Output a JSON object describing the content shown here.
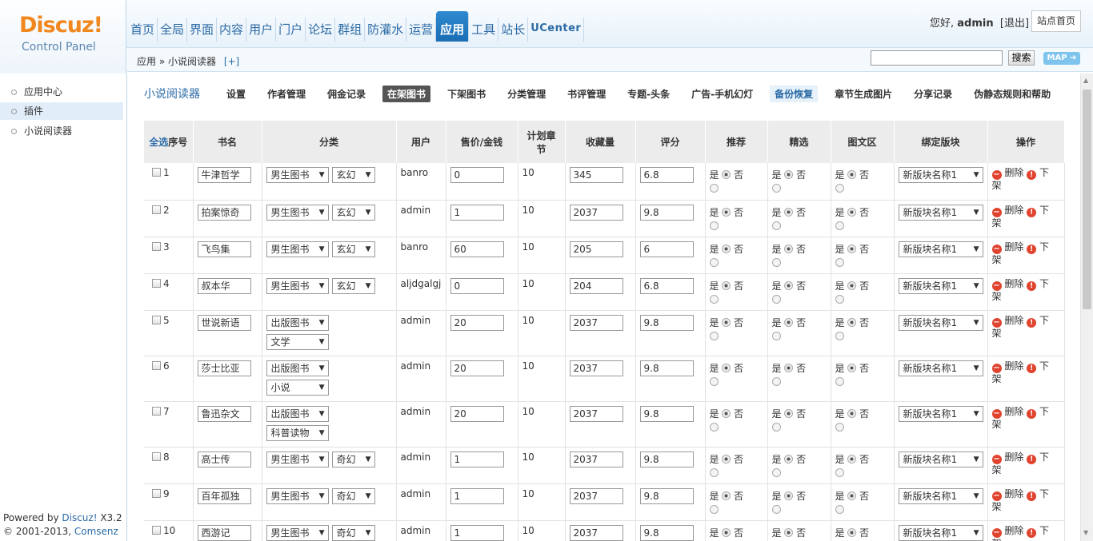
{
  "header": {
    "logo_brand": "Discuz!",
    "logo_sub": "Control Panel",
    "nav": [
      "首页",
      "全局",
      "界面",
      "内容",
      "用户",
      "门户",
      "论坛",
      "群组",
      "防灌水",
      "运营",
      "应用",
      "工具",
      "站长",
      "UCenter"
    ],
    "active_nav": "应用",
    "greeting": "您好,",
    "username": "admin",
    "logout": "[退出]",
    "site_home": "站点首页"
  },
  "subbar": {
    "breadcrumb": "应用 » 小说阅读器",
    "add_label": "[+]",
    "search_button": "搜索",
    "map_button": "MAP ➜"
  },
  "sidebar": {
    "items": [
      "应用中心",
      "插件",
      "小说阅读器"
    ],
    "active_item": "插件",
    "footer_powered": "Powered by ",
    "footer_brand": "Discuz!",
    "footer_version": " X3.2",
    "footer_copyright": "© 2001-2013, ",
    "footer_company": "Comsenz Inc."
  },
  "tabs": {
    "app_title": "小说阅读器",
    "items": [
      "设置",
      "作者管理",
      "佣金记录",
      "在架图书",
      "下架图书",
      "分类管理",
      "书评管理",
      "专题-头条",
      "广告-手机幻灯",
      "备份恢复",
      "章节生成图片",
      "分享记录",
      "伪静态规则和帮助"
    ],
    "active_tab": "在架图书",
    "highlighted_tab": "备份恢复"
  },
  "table": {
    "headers": {
      "select_all": "全选",
      "index": "序号",
      "book": "书名",
      "category": "分类",
      "user": "用户",
      "price": "售价/金钱",
      "chapters": "计划章节",
      "favorites": "收藏量",
      "score": "评分",
      "recommend": "推荐",
      "featured": "精选",
      "picture": "图文区",
      "block": "绑定版块",
      "actions": "操作"
    },
    "yes": "是",
    "no": "否",
    "delete": "删除",
    "offshelf_1": "下",
    "offshelf_2": "架",
    "rows": [
      {
        "idx": "1",
        "title": "牛津哲学",
        "cat1": "男生图书",
        "cat2": "玄幻",
        "user": "banro",
        "price": "0",
        "chapters": "10",
        "fav": "345",
        "score": "6.8",
        "block": "新版块名称1"
      },
      {
        "idx": "2",
        "title": "拍案惊奇",
        "cat1": "男生图书",
        "cat2": "玄幻",
        "user": "admin",
        "price": "1",
        "chapters": "10",
        "fav": "2037",
        "score": "9.8",
        "block": "新版块名称1"
      },
      {
        "idx": "3",
        "title": "飞鸟集",
        "cat1": "男生图书",
        "cat2": "玄幻",
        "user": "banro",
        "price": "60",
        "chapters": "10",
        "fav": "205",
        "score": "6",
        "block": "新版块名称1"
      },
      {
        "idx": "4",
        "title": "叔本华",
        "cat1": "男生图书",
        "cat2": "玄幻",
        "user": "aljdgalgj",
        "price": "0",
        "chapters": "10",
        "fav": "204",
        "score": "6.8",
        "block": "新版块名称1"
      },
      {
        "idx": "5",
        "title": "世说新语",
        "cat1": "出版图书",
        "cat2": "文学",
        "user": "admin",
        "price": "20",
        "chapters": "10",
        "fav": "2037",
        "score": "9.8",
        "block": "新版块名称1",
        "stacked": true
      },
      {
        "idx": "6",
        "title": "莎士比亚",
        "cat1": "出版图书",
        "cat2": "小说",
        "user": "admin",
        "price": "20",
        "chapters": "10",
        "fav": "2037",
        "score": "9.8",
        "block": "新版块名称1",
        "stacked": true
      },
      {
        "idx": "7",
        "title": "鲁迅杂文",
        "cat1": "出版图书",
        "cat2": "科普读物",
        "user": "admin",
        "price": "20",
        "chapters": "10",
        "fav": "2037",
        "score": "9.8",
        "block": "新版块名称1",
        "stacked": true
      },
      {
        "idx": "8",
        "title": "高士传",
        "cat1": "男生图书",
        "cat2": "奇幻",
        "user": "admin",
        "price": "1",
        "chapters": "10",
        "fav": "2037",
        "score": "9.8",
        "block": "新版块名称1"
      },
      {
        "idx": "9",
        "title": "百年孤独",
        "cat1": "男生图书",
        "cat2": "奇幻",
        "user": "admin",
        "price": "1",
        "chapters": "10",
        "fav": "2037",
        "score": "9.8",
        "block": "新版块名称1"
      },
      {
        "idx": "10",
        "title": "西游记",
        "cat1": "男生图书",
        "cat2": "奇幻",
        "user": "admin",
        "price": "1",
        "chapters": "10",
        "fav": "2037",
        "score": "9.8",
        "block": "新版块名称1"
      }
    ]
  },
  "colors": {
    "brand_orange": "#f0881f",
    "link_blue": "#2b6aa5",
    "active_nav_blue": "#1b6db4",
    "danger_red": "#d9382a"
  }
}
